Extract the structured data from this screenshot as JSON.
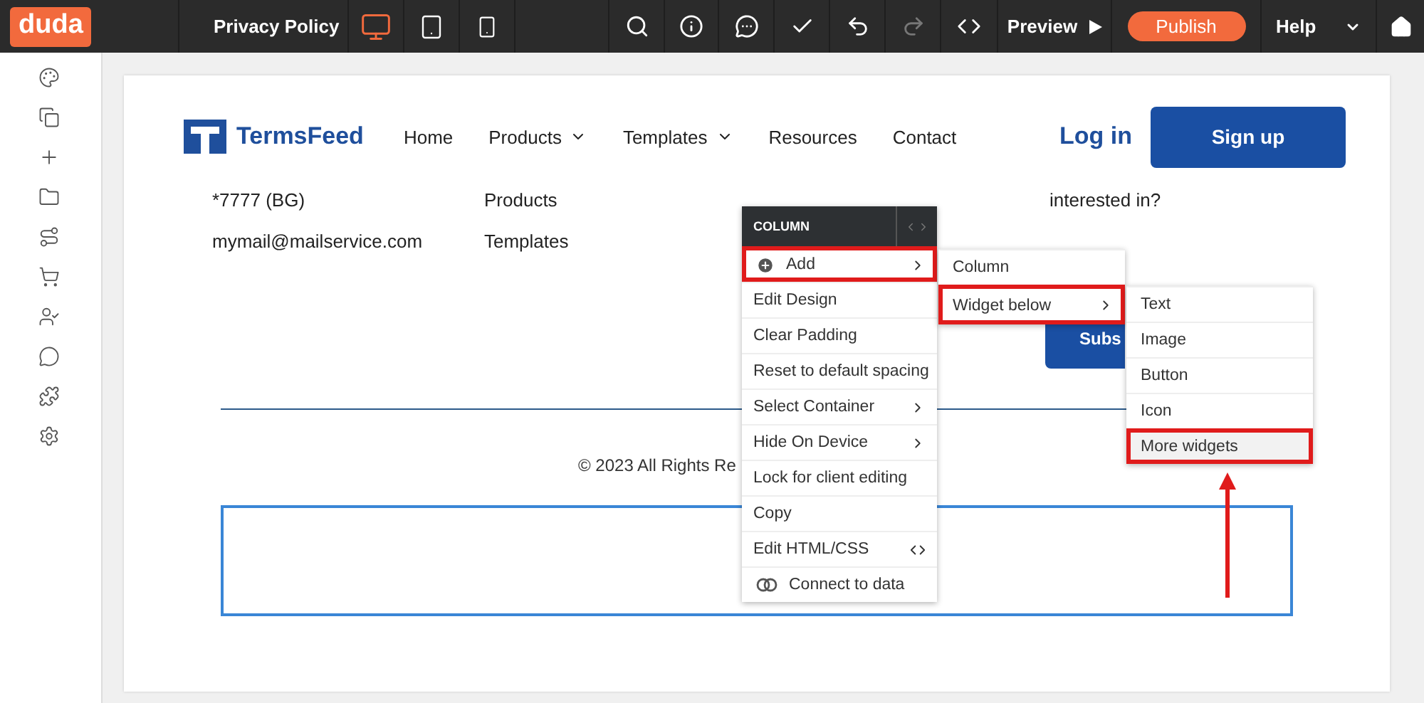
{
  "toolbar": {
    "logo": "duda",
    "page_selector": "Privacy Policy",
    "devices": [
      {
        "kind": "desktop",
        "selected": true
      },
      {
        "kind": "tablet",
        "selected": false
      },
      {
        "kind": "mobile",
        "selected": false
      }
    ],
    "tools": [
      {
        "kind": "search",
        "disabled": false
      },
      {
        "kind": "info",
        "disabled": false
      },
      {
        "kind": "comment",
        "disabled": false
      },
      {
        "kind": "check",
        "disabled": false
      },
      {
        "kind": "undo",
        "disabled": false
      },
      {
        "kind": "redo",
        "disabled": true
      },
      {
        "kind": "code",
        "disabled": false
      }
    ],
    "preview": "Preview",
    "publish": "Publish",
    "help": "Help"
  },
  "sidebar": {
    "items": [
      {
        "kind": "palette"
      },
      {
        "kind": "pages"
      },
      {
        "kind": "add"
      },
      {
        "kind": "folder"
      },
      {
        "kind": "route"
      },
      {
        "kind": "cart"
      },
      {
        "kind": "user"
      },
      {
        "kind": "comment"
      },
      {
        "kind": "puzzle"
      },
      {
        "kind": "settings"
      }
    ]
  },
  "site": {
    "logo": "TermsFeed",
    "nav": [
      {
        "label": "Home",
        "dropdown": false
      },
      {
        "label": "Products",
        "dropdown": true
      },
      {
        "label": "Templates",
        "dropdown": true
      },
      {
        "label": "Resources",
        "dropdown": false
      },
      {
        "label": "Contact",
        "dropdown": false
      }
    ],
    "login": "Log in",
    "signup": "Sign up",
    "footer": {
      "column_1": [
        "*7777 (BG)",
        "mymail@mailservice.com"
      ],
      "column_2": [
        "Products",
        "Templates"
      ],
      "column_4": [
        "interested in?"
      ],
      "subscribe": "Subs",
      "copyright": "© 2023 All Rights Re"
    }
  },
  "context_menu": {
    "title": "COLUMN",
    "items": [
      {
        "label": "Add",
        "kind": "add",
        "submenu": true,
        "selected": true
      },
      {
        "label": "Edit Design",
        "kind": "plain",
        "submenu": false,
        "selected": false
      },
      {
        "label": "Clear Padding",
        "kind": "plain",
        "submenu": false,
        "selected": false
      },
      {
        "label": "Reset to default spacing",
        "kind": "plain",
        "submenu": false,
        "selected": false
      },
      {
        "label": "Select Container",
        "kind": "plain",
        "submenu": true,
        "selected": false
      },
      {
        "label": "Hide On Device",
        "kind": "plain",
        "submenu": true,
        "selected": false
      },
      {
        "label": "Lock for client editing",
        "kind": "plain",
        "submenu": false,
        "selected": false
      },
      {
        "label": "Copy",
        "kind": "plain",
        "submenu": false,
        "selected": false
      },
      {
        "label": "Edit HTML/CSS",
        "kind": "code",
        "submenu": false,
        "selected": false
      },
      {
        "label": "Connect to data",
        "kind": "data",
        "submenu": false,
        "selected": false
      }
    ]
  },
  "add_menu": {
    "items": [
      {
        "label": "Column",
        "submenu": false,
        "selected": false
      },
      {
        "label": "Widget below",
        "submenu": true,
        "selected": true
      }
    ]
  },
  "widget_menu": {
    "items": [
      {
        "label": "Text",
        "selected": false
      },
      {
        "label": "Image",
        "selected": false
      },
      {
        "label": "Button",
        "selected": false
      },
      {
        "label": "Icon",
        "selected": false
      },
      {
        "label": "More widgets",
        "selected": true
      }
    ]
  }
}
